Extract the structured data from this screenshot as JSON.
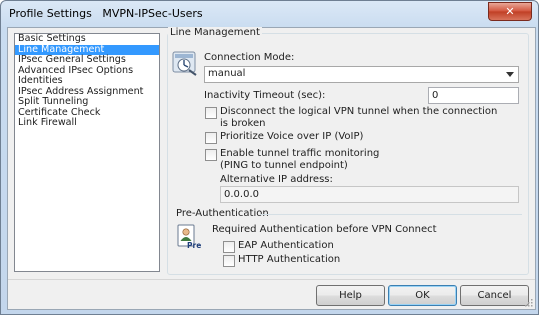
{
  "window": {
    "title_prefix": "Profile Settings",
    "title_profile": "MVPN-IPSec-Users",
    "close_glyph": "✕"
  },
  "nav": {
    "items": [
      {
        "label": "Basic Settings",
        "selected": false
      },
      {
        "label": "Line Management",
        "selected": true
      },
      {
        "label": "IPsec General Settings",
        "selected": false
      },
      {
        "label": "Advanced IPsec Options",
        "selected": false
      },
      {
        "label": "Identities",
        "selected": false
      },
      {
        "label": "IPsec Address Assignment",
        "selected": false
      },
      {
        "label": "Split Tunneling",
        "selected": false
      },
      {
        "label": "Certificate Check",
        "selected": false
      },
      {
        "label": "Link Firewall",
        "selected": false
      }
    ]
  },
  "line_management": {
    "section_title": "Line Management",
    "connection_mode_label": "Connection Mode:",
    "connection_mode_value": "manual",
    "inactivity_label": "Inactivity Timeout (sec):",
    "inactivity_value": "0",
    "disconnect_label_line1": "Disconnect the logical VPN tunnel when the connection",
    "disconnect_label_line2": "is broken",
    "disconnect_checked": false,
    "voip_label": "Prioritize Voice over IP (VoIP)",
    "voip_checked": false,
    "monitoring_label_line1": "Enable tunnel traffic monitoring",
    "monitoring_label_line2": "(PING to tunnel endpoint)",
    "monitoring_checked": false,
    "alt_ip_label": "Alternative IP address:",
    "alt_ip_value": "0.0.0.0"
  },
  "pre_auth": {
    "section_title": "Pre-Authentication",
    "required_label": "Required Authentication before VPN Connect",
    "eap_label": "EAP Authentication",
    "eap_checked": false,
    "http_label": "HTTP Authentication",
    "http_checked": false,
    "icon_text": "Pre"
  },
  "buttons": {
    "help": "Help",
    "ok": "OK",
    "cancel": "Cancel"
  }
}
